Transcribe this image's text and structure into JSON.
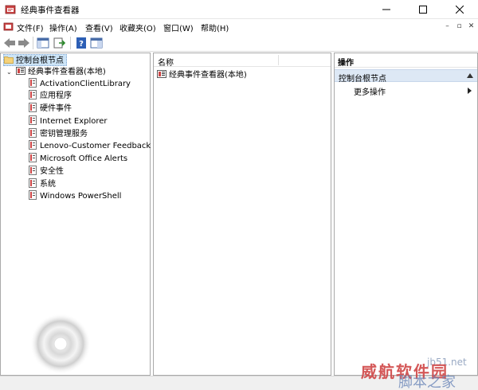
{
  "window": {
    "title": "经典事件查看器"
  },
  "menubar": {
    "items": [
      "文件(F)",
      "操作(A)",
      "查看(V)",
      "收藏夹(O)",
      "窗口(W)",
      "帮助(H)"
    ]
  },
  "tree": {
    "root": "控制台根节点",
    "node": "经典事件查看器(本地)",
    "logs": [
      "ActivationClientLibrary",
      "应用程序",
      "硬件事件",
      "Internet Explorer",
      "密钥管理服务",
      "Lenovo-Customer Feedback",
      "Microsoft Office Alerts",
      "安全性",
      "系统",
      "Windows PowerShell"
    ]
  },
  "center": {
    "column_header": "名称",
    "items": [
      "经典事件查看器(本地)"
    ]
  },
  "actions": {
    "header": "操作",
    "section": "控制台根节点",
    "items": [
      "更多操作"
    ]
  },
  "watermark": {
    "url": "jb51.net",
    "main": "威航软件园",
    "sub": "脚本之家"
  },
  "colors": {
    "accent": "#0078d7",
    "selection": "#cce4f7",
    "section_bg": "#dde8f5"
  }
}
